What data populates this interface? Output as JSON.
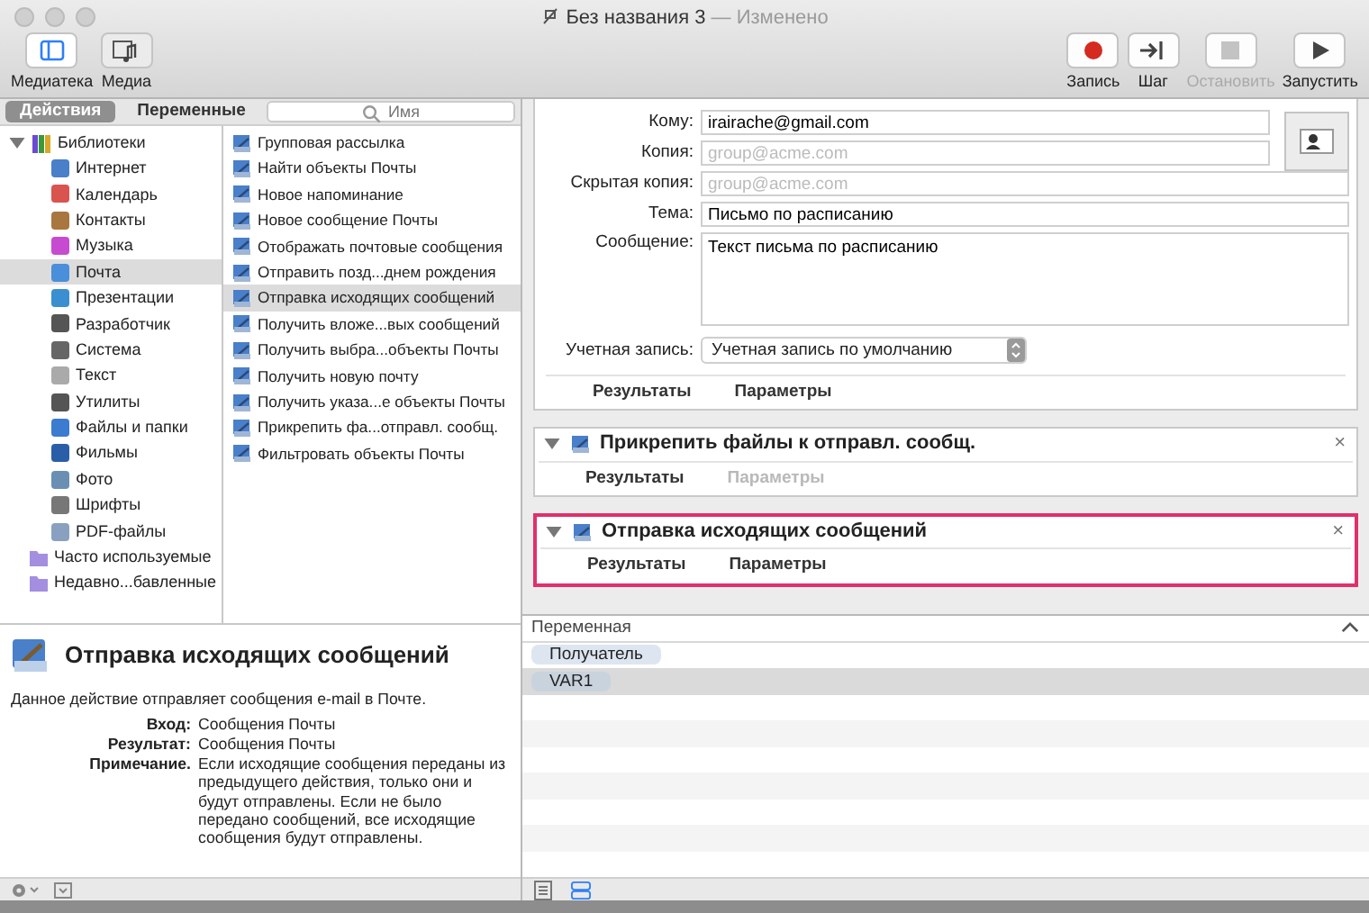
{
  "window": {
    "title": "Без названия 3",
    "status": "— Изменено"
  },
  "toolbar": {
    "left": [
      {
        "label": "Медиатека",
        "kind": "library",
        "selected": true
      },
      {
        "label": "Медиа",
        "kind": "media",
        "selected": false
      }
    ],
    "right": [
      {
        "label": "Запись",
        "kind": "record",
        "disabled": false
      },
      {
        "label": "Шаг",
        "kind": "step",
        "disabled": false
      },
      {
        "label": "Остановить",
        "kind": "stop",
        "disabled": true
      },
      {
        "label": "Запустить",
        "kind": "run",
        "disabled": false
      }
    ]
  },
  "library_tabs": [
    {
      "label": "Действия",
      "selected": true
    },
    {
      "label": "Переменные",
      "selected": false
    }
  ],
  "search": {
    "placeholder": "Имя"
  },
  "libraries": {
    "label": "Библиотеки",
    "expanded": true,
    "children": [
      {
        "label": "Интернет",
        "selected": false
      },
      {
        "label": "Календарь",
        "selected": false
      },
      {
        "label": "Контакты",
        "selected": false
      },
      {
        "label": "Музыка",
        "selected": false
      },
      {
        "label": "Почта",
        "selected": true
      },
      {
        "label": "Презентации",
        "selected": false
      },
      {
        "label": "Разработчик",
        "selected": false
      },
      {
        "label": "Система",
        "selected": false
      },
      {
        "label": "Текст",
        "selected": false
      },
      {
        "label": "Утилиты",
        "selected": false
      },
      {
        "label": "Файлы и папки",
        "selected": false
      },
      {
        "label": "Фильмы",
        "selected": false
      },
      {
        "label": "Фото",
        "selected": false
      },
      {
        "label": "Шрифты",
        "selected": false
      },
      {
        "label": "PDF-файлы",
        "selected": false
      }
    ]
  },
  "smart_folders": [
    {
      "label": "Часто используемые",
      "selected": false
    },
    {
      "label": "Недавно...бавленные",
      "selected": false
    }
  ],
  "actions": [
    {
      "label": "Групповая рассылка",
      "selected": false
    },
    {
      "label": "Найти объекты Почты",
      "selected": false
    },
    {
      "label": "Новое напоминание",
      "selected": false
    },
    {
      "label": "Новое сообщение Почты",
      "selected": false
    },
    {
      "label": "Отображать почтовые сообщения",
      "selected": false
    },
    {
      "label": "Отправить позд...днем рождения",
      "selected": false
    },
    {
      "label": "Отправка исходящих сообщений",
      "selected": true
    },
    {
      "label": "Получить вложе...вых сообщений",
      "selected": false
    },
    {
      "label": "Получить выбра...объекты Почты",
      "selected": false
    },
    {
      "label": "Получить новую почту",
      "selected": false
    },
    {
      "label": "Получить указа...е объекты Почты",
      "selected": false
    },
    {
      "label": "Прикрепить фа...отправл. сообщ.",
      "selected": false
    },
    {
      "label": "Фильтровать объекты Почты",
      "selected": false
    }
  ],
  "description": {
    "title": "Отправка исходящих сообщений",
    "text": "Данное действие отправляет сообщения e-mail в Почте.",
    "fields": [
      {
        "label": "Вход:",
        "value": "Сообщения Почты"
      },
      {
        "label": "Результат:",
        "value": "Сообщения Почты"
      },
      {
        "label": "Примечание.",
        "value": "Если исходящие сообщения переданы из предыдущего действия, только они и будут отправлены. Если не было передано сообщений, все исходящие сообщения будут отправлены."
      }
    ]
  },
  "mail_form": {
    "fields": [
      {
        "label": "Кому:",
        "value": "irairache@gmail.com"
      },
      {
        "label": "Копия:",
        "placeholder": "group@acme.com"
      },
      {
        "label": "Скрытая копия:",
        "placeholder": "group@acme.com"
      },
      {
        "label": "Тема:",
        "value": "Письмо по расписанию"
      }
    ],
    "message": {
      "label": "Сообщение:",
      "value": "Текст письма по расписанию"
    },
    "account": {
      "label": "Учетная запись:",
      "value": "Учетная запись по умолчанию"
    },
    "tabs": [
      {
        "label": "Результаты",
        "disabled": false
      },
      {
        "label": "Параметры",
        "disabled": false
      }
    ]
  },
  "workflow_actions": [
    {
      "title": "Прикрепить файлы к отправл. сообщ.",
      "close": "×",
      "selected": false,
      "tabs": [
        {
          "label": "Результаты",
          "disabled": false
        },
        {
          "label": "Параметры",
          "disabled": true
        }
      ]
    },
    {
      "title": "Отправка исходящих сообщений",
      "close": "×",
      "selected": true,
      "tabs": [
        {
          "label": "Результаты",
          "disabled": false
        },
        {
          "label": "Параметры",
          "disabled": false
        }
      ]
    }
  ],
  "variables": {
    "header": "Переменная",
    "rows": [
      {
        "name": "Получатель",
        "selected": false
      },
      {
        "name": "VAR1",
        "selected": true
      }
    ]
  }
}
